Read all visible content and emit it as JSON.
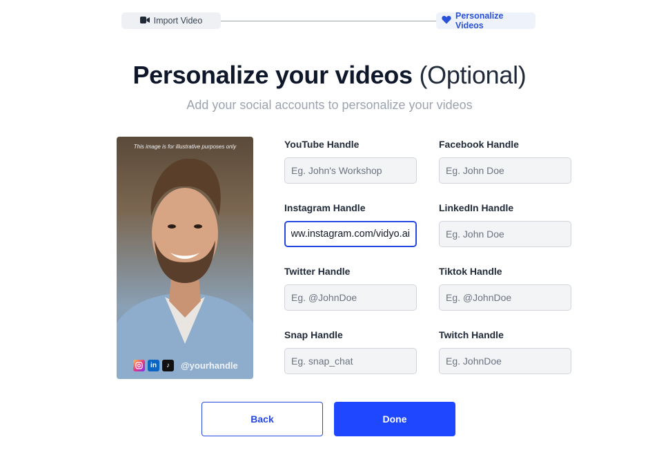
{
  "stepper": {
    "steps": [
      {
        "label": "Import Video",
        "icon": "video-camera-icon",
        "state": "completed"
      },
      {
        "label": "Personalize Videos",
        "icon": "heart-icon",
        "state": "active"
      }
    ]
  },
  "header": {
    "title": "Personalize your videos",
    "title_suffix": "(Optional)",
    "subtitle": "Add your social accounts to personalize your videos"
  },
  "preview": {
    "disclaimer": "This image is for illustrative purposes only",
    "handle": "@yourhandle",
    "social_icons": [
      "instagram-icon",
      "linkedin-icon",
      "tiktok-icon"
    ]
  },
  "form": {
    "fields": [
      {
        "label": "YouTube Handle",
        "placeholder": "Eg. John's Workshop",
        "value": ""
      },
      {
        "label": "Facebook Handle",
        "placeholder": "Eg. John Doe",
        "value": ""
      },
      {
        "label": "Instagram Handle",
        "placeholder": "",
        "value": "www.instagram.com/vidyo.ai/"
      },
      {
        "label": "LinkedIn Handle",
        "placeholder": "Eg. John Doe",
        "value": ""
      },
      {
        "label": "Twitter Handle",
        "placeholder": "Eg. @JohnDoe",
        "value": ""
      },
      {
        "label": "Tiktok Handle",
        "placeholder": "Eg. @JohnDoe",
        "value": ""
      },
      {
        "label": "Snap Handle",
        "placeholder": "Eg. snap_chat",
        "value": ""
      },
      {
        "label": "Twitch Handle",
        "placeholder": "Eg. JohnDoe",
        "value": ""
      }
    ]
  },
  "actions": {
    "back_label": "Back",
    "done_label": "Done"
  },
  "colors": {
    "primary": "#1f47ff",
    "active_step_text": "#2a52d9",
    "subtitle": "#9ca3af"
  }
}
